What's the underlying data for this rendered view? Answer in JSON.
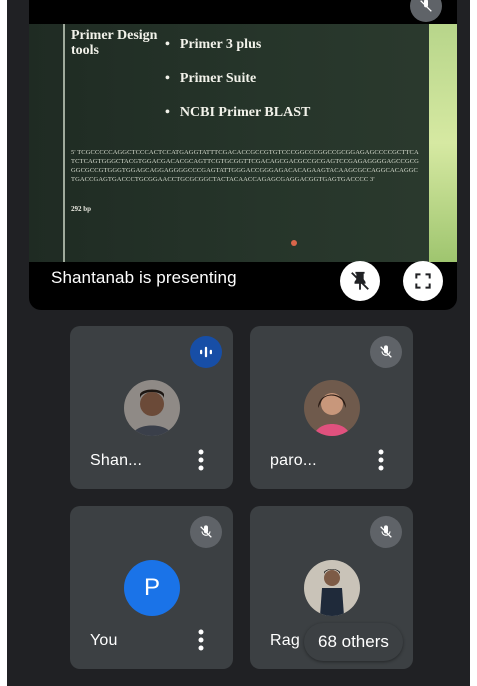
{
  "presentation": {
    "slide_title": "Primer Design tools",
    "bullets": [
      "Primer 3 plus",
      "Primer Suite",
      "NCBI Primer BLAST"
    ],
    "sequence": "5' TCGCCCCCAGGCTCCCACTCCATGAGGTATTTCGACACCGCCGTGTCCCGGCCCGGCCGCGGAGAGCCCCGCTTCATCTCAGTGGGCTACGTGGACGACACGCAGTTCGTGCGGTTCGACAGCGACGCCGCGAGTCCGAGAGGGGAGCCGCGGGCGCCGTGGGTGGAGCAGGAGGGGCCCGAGTATTGGGACCGGGAGACACAGAAGTACAAGCGCCAGGCACAGGCTGACCGAGTGACCCTGCGGAACCTGCGCGGCTACTACAACCAGAGCGAGGACGGTGAGTGACCCC 3'",
    "bp_label": "292 bp",
    "presenter_label": "Shantanab is presenting"
  },
  "participants": [
    {
      "name": "Shan...",
      "avatar_type": "photo",
      "mic": "speaking"
    },
    {
      "name": "paro...",
      "avatar_type": "photo",
      "mic": "muted"
    },
    {
      "name": "You",
      "avatar_type": "letter",
      "letter": "P",
      "mic": "muted"
    },
    {
      "name": "Rag",
      "avatar_type": "photo",
      "mic": "muted"
    }
  ],
  "others_label": "68 others",
  "icons": {
    "mic_off": "mic-off-icon",
    "speaking": "audio-level-icon",
    "pin_off": "unpin-icon",
    "fullscreen": "fullscreen-icon",
    "more": "more-vert-icon"
  },
  "colors": {
    "background": "#202124",
    "tile": "#3c4043",
    "muted_badge": "#5f6368",
    "speaking_badge": "#174ea6",
    "avatar_letter_bg": "#1a73e8"
  }
}
